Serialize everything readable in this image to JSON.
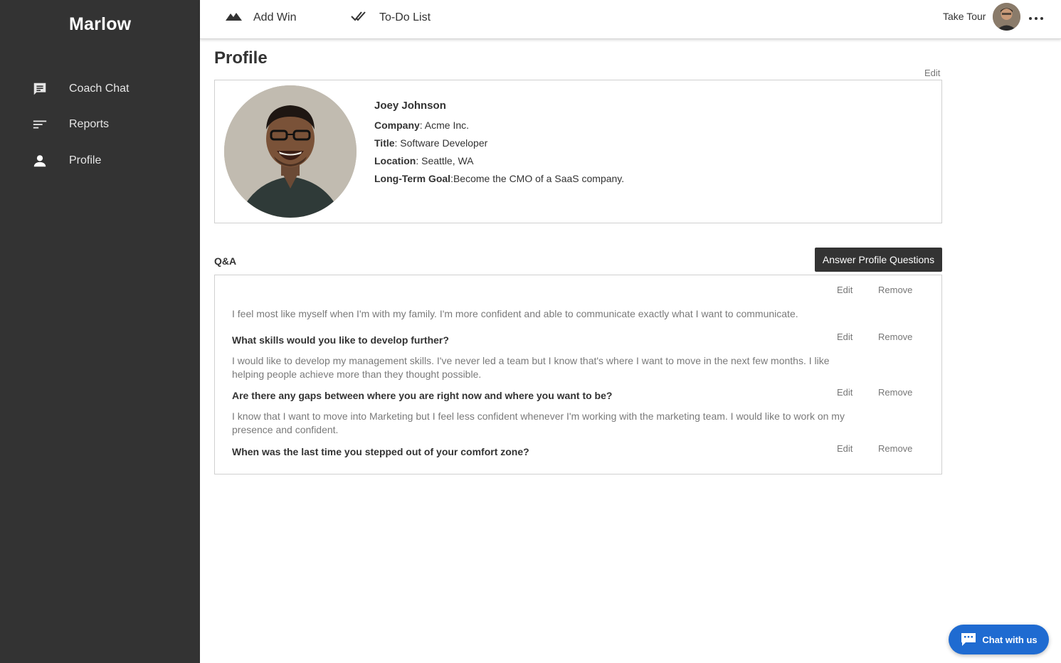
{
  "app": {
    "brand": "Marlow"
  },
  "sidebar": {
    "items": [
      {
        "label": "Coach Chat",
        "icon": "chat-icon"
      },
      {
        "label": "Reports",
        "icon": "reports-icon"
      },
      {
        "label": "Profile",
        "icon": "person-icon"
      }
    ]
  },
  "topbar": {
    "add_win": "Add Win",
    "todo": "To-Do List",
    "take_tour": "Take Tour"
  },
  "page": {
    "title": "Profile",
    "edit_label": "Edit"
  },
  "profile": {
    "name": "Joey Johnson",
    "company_label": "Company",
    "company": ": Acme Inc.",
    "title_label": "Title",
    "title": ": Software Developer",
    "location_label": "Location",
    "location": ": Seattle, WA",
    "goal_label": "Long-Term Goal",
    "goal": ":Become the CMO of a SaaS company."
  },
  "qa": {
    "title": "Q&A",
    "answer_button": "Answer Profile Questions",
    "edit_label": "Edit",
    "remove_label": "Remove",
    "items": [
      {
        "question": "",
        "answer": "I feel most like myself when I'm with my family. I'm more confident and able to communicate exactly what I want to communicate."
      },
      {
        "question": "What skills would you like to develop further?",
        "answer": "I would like to develop my management skills. I've never led a team but I know that's where I want to move in the next few months. I like helping people achieve more than they thought possible."
      },
      {
        "question": "Are there any gaps between where you are right now and where you want to be?",
        "answer": "I know that I want to move into Marketing but I feel less confident whenever I'm working with the marketing team. I would like to work on my presence and confident."
      },
      {
        "question": "When was the last time you stepped out of your comfort zone?",
        "answer": ""
      }
    ]
  },
  "chat_widget": {
    "label": "Chat with us"
  },
  "colors": {
    "sidebar": "#333333",
    "accent": "#1f6bd1",
    "button_dark": "#333333"
  }
}
